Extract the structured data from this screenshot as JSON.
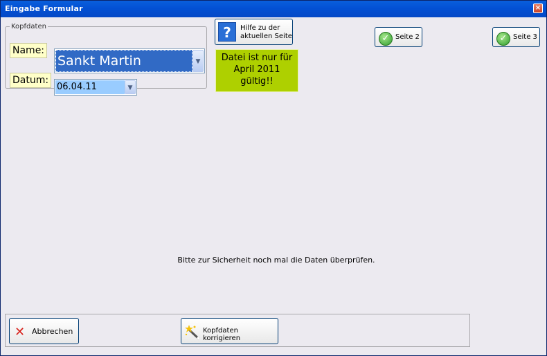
{
  "window": {
    "title": "Eingabe Formular",
    "close_symbol": "×"
  },
  "kopfdaten": {
    "legend": "Kopfdaten",
    "name_label": "Name:",
    "name_value": "Sankt Martin",
    "datum_label": "Datum:",
    "datum_value": "06.04.11",
    "dropdown_arrow": "▼"
  },
  "help_button": {
    "icon_text": "?",
    "label_line1": "Hilfe zu der",
    "label_line2": "aktuellen Seite"
  },
  "page_buttons": {
    "seite2": "Seite 2",
    "seite3": "Seite 3"
  },
  "notice": {
    "line1": "Datei ist nur für",
    "line2": "April 2011 gültig!!",
    "bg_color": "#aed000"
  },
  "hint_text": "Bitte zur Sicherheit noch mal die Daten überprüfen.",
  "footer": {
    "cancel": "Abbrechen",
    "correct": "Kopfdaten korrigieren"
  },
  "icons": {
    "help": "help-icon",
    "check": "check-icon",
    "cancel": "x-icon",
    "wand": "magic-wand-icon"
  }
}
